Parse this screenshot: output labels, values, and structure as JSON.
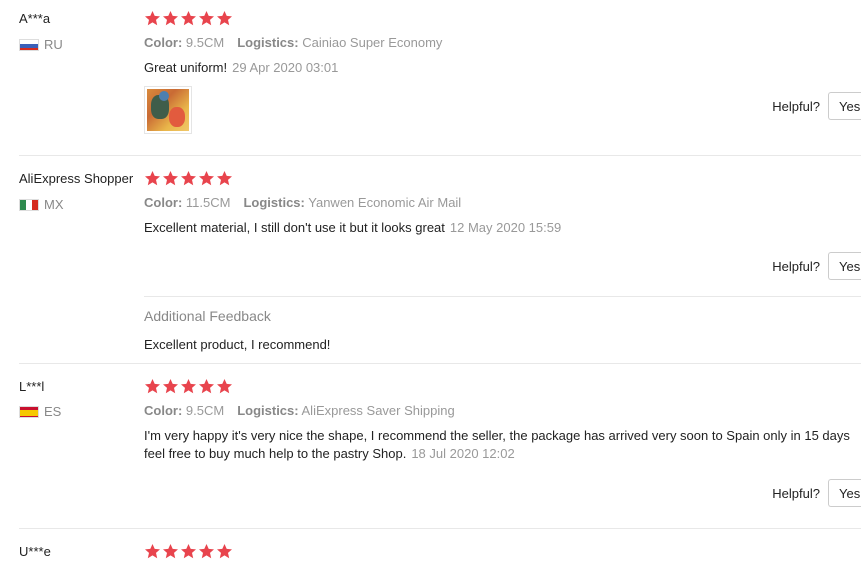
{
  "colors": {
    "star": "#e8444d",
    "muted": "#999999",
    "text": "#222222"
  },
  "helpful_label": "Helpful?",
  "yes_label": "Yes",
  "reviews": [
    {
      "user": "A***a",
      "country": "RU",
      "flag": "russia-flag-icon",
      "rating": 5,
      "color_label": "Color:",
      "color_value": "9.5CM",
      "logistics_label": "Logistics:",
      "logistics_value": "Cainiao Super Economy",
      "text": "Great uniform!",
      "date": "29 Apr 2020 03:01",
      "has_photo": true
    },
    {
      "user": "AliExpress Shopper",
      "country": "MX",
      "flag": "mexico-flag-icon",
      "rating": 5,
      "color_label": "Color:",
      "color_value": "11.5CM",
      "logistics_label": "Logistics:",
      "logistics_value": "Yanwen Economic Air Mail",
      "text": "Excellent material, I still don't use it but it looks great",
      "date": "12 May 2020 15:59",
      "additional_title": "Additional Feedback",
      "additional_text": "Excellent product, I recommend!"
    },
    {
      "user": "L***l",
      "country": "ES",
      "flag": "spain-flag-icon",
      "rating": 5,
      "color_label": "Color:",
      "color_value": "9.5CM",
      "logistics_label": "Logistics:",
      "logistics_value": "AliExpress Saver Shipping",
      "text": "I'm very happy it's very nice the shape, I recommend the seller, the package has arrived very soon to Spain only in 15 days feel free to buy much help to the pastry Shop.",
      "date": "18 Jul 2020 12:02"
    },
    {
      "user": "U***e",
      "rating": 5
    }
  ]
}
